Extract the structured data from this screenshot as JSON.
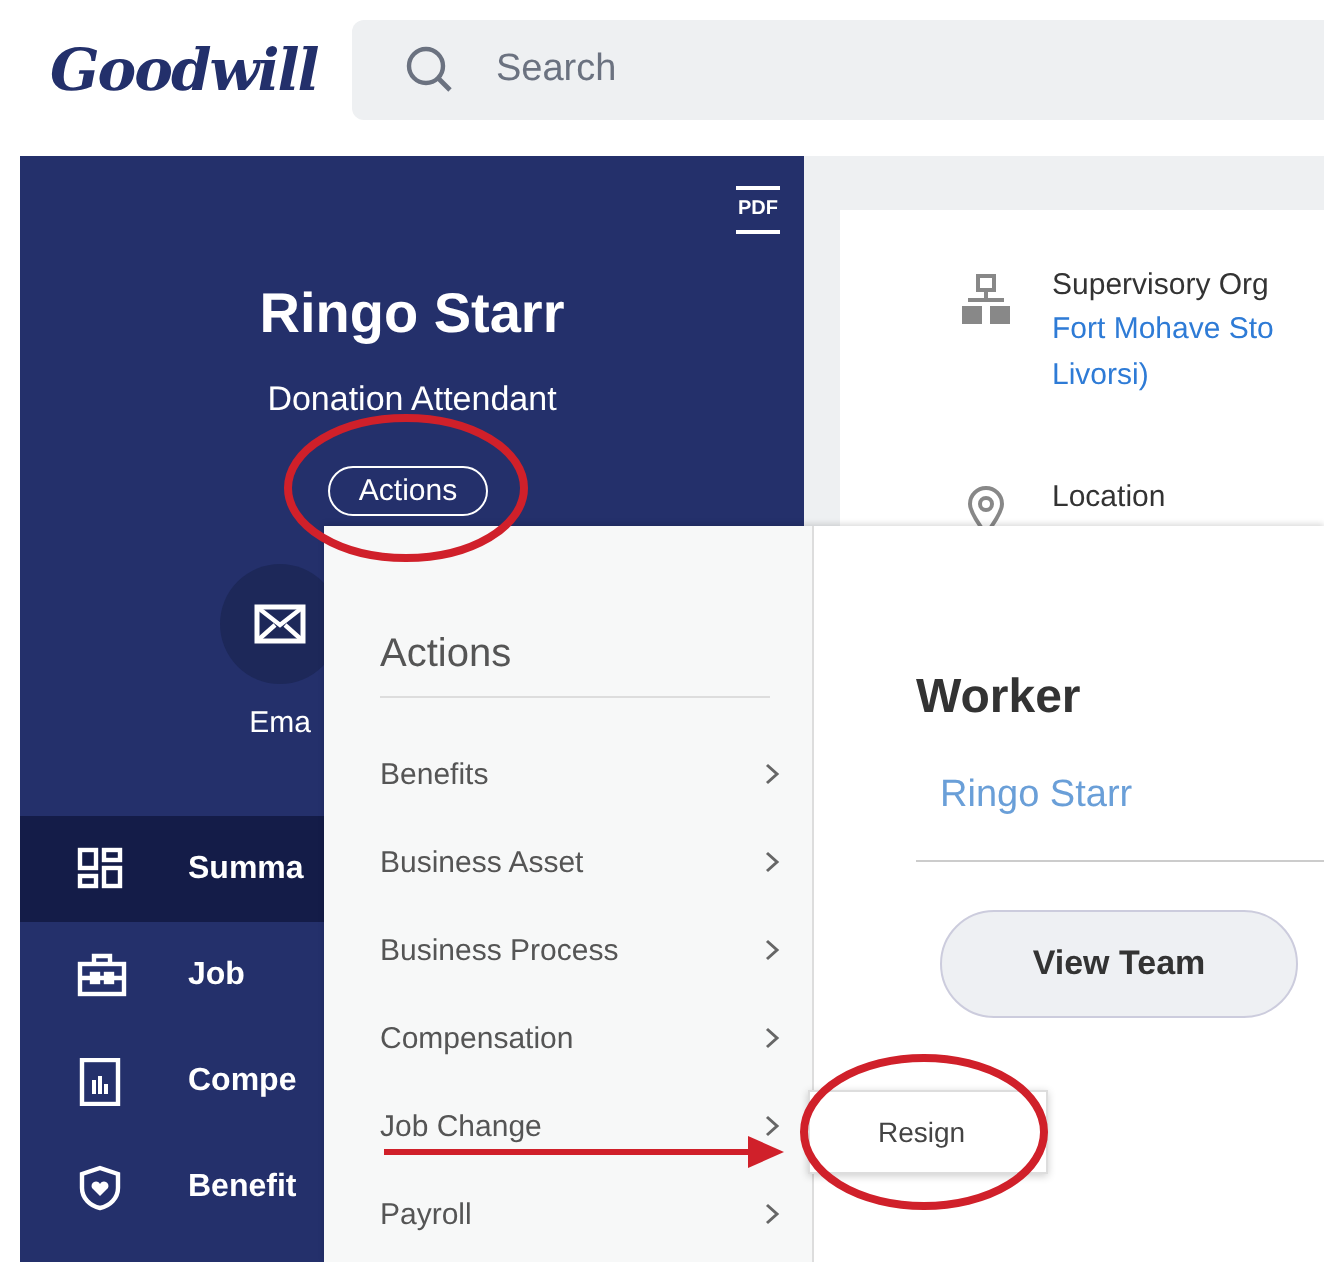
{
  "header": {
    "logo": "Goodwill",
    "search": {
      "placeholder": "Search"
    }
  },
  "profile": {
    "pdf_label": "PDF",
    "name": "Ringo Starr",
    "title": "Donation Attendant",
    "actions_button": "Actions",
    "contacts": [
      {
        "kind": "email",
        "label": "Ema"
      }
    ]
  },
  "nav": [
    {
      "kind": "summary",
      "label": "Summa",
      "selected": true
    },
    {
      "kind": "job",
      "label": "Job",
      "selected": false
    },
    {
      "kind": "compensation",
      "label": "Compe",
      "selected": false
    },
    {
      "kind": "benefits",
      "label": "Benefit",
      "selected": false
    }
  ],
  "details": [
    {
      "kind": "org",
      "label": "Supervisory Org",
      "link_lines": [
        "Fort Mohave Sto",
        "Livorsi)"
      ]
    },
    {
      "kind": "location",
      "label": "Location"
    }
  ],
  "actions_menu": {
    "title": "Actions",
    "items": [
      {
        "label": "Benefits"
      },
      {
        "label": "Business Asset"
      },
      {
        "label": "Business Process"
      },
      {
        "label": "Compensation"
      },
      {
        "label": "Job Change"
      },
      {
        "label": "Payroll"
      }
    ]
  },
  "submenu": {
    "items": [
      "Resign"
    ]
  },
  "worker": {
    "heading": "Worker",
    "name": "Ringo Starr",
    "button": "View Team"
  }
}
